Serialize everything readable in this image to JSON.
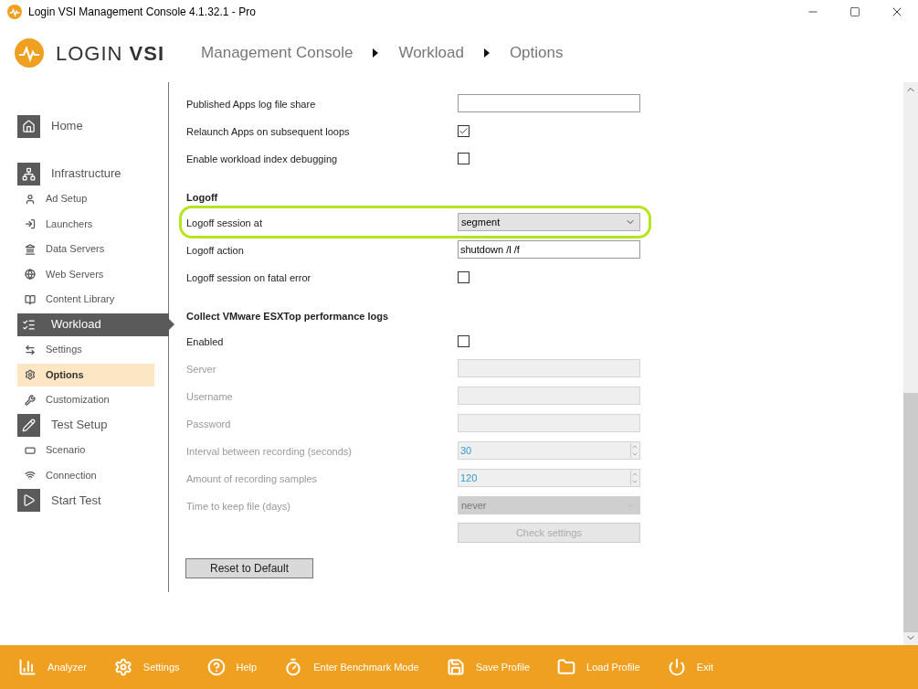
{
  "window": {
    "title": "Login VSI Management Console 4.1.32.1 - Pro"
  },
  "header": {
    "brand_light": "LOGIN",
    "brand_bold": "VSI",
    "breadcrumb": [
      "Management Console",
      "Workload",
      "Options"
    ]
  },
  "sidebar": {
    "items": [
      {
        "kind": "section",
        "label": "Home",
        "selected": false
      },
      {
        "kind": "section",
        "label": "Infrastructure",
        "selected": false
      },
      {
        "kind": "sub",
        "label": "Ad Setup",
        "selected": false
      },
      {
        "kind": "sub",
        "label": "Launchers",
        "selected": false
      },
      {
        "kind": "sub",
        "label": "Data Servers",
        "selected": false
      },
      {
        "kind": "sub",
        "label": "Web Servers",
        "selected": false
      },
      {
        "kind": "sub",
        "label": "Content Library",
        "selected": false
      },
      {
        "kind": "section",
        "label": "Workload",
        "selected": true
      },
      {
        "kind": "sub",
        "label": "Settings",
        "selected": false
      },
      {
        "kind": "sub",
        "label": "Options",
        "selected": true
      },
      {
        "kind": "sub",
        "label": "Customization",
        "selected": false
      },
      {
        "kind": "section",
        "label": "Test Setup",
        "selected": false
      },
      {
        "kind": "sub",
        "label": "Scenario",
        "selected": false
      },
      {
        "kind": "sub",
        "label": "Connection",
        "selected": false
      },
      {
        "kind": "section",
        "label": "Start Test",
        "selected": false
      }
    ]
  },
  "form": {
    "rows": [
      {
        "kind": "text",
        "label": "Published Apps log file share",
        "disabled": false,
        "highlighted": false
      },
      {
        "kind": "checkbox",
        "label": "Relaunch Apps on subsequent loops",
        "checked": true,
        "disabled": false,
        "highlighted": false
      },
      {
        "kind": "checkbox",
        "label": "Enable workload index debugging",
        "checked": false,
        "disabled": false,
        "highlighted": false
      },
      {
        "kind": "heading",
        "label": "Logoff"
      },
      {
        "kind": "select",
        "label": "Logoff session at",
        "value": "segment",
        "disabled": false,
        "highlighted": true
      },
      {
        "kind": "text",
        "label": "Logoff action",
        "value": "shutdown /l /f",
        "disabled": false,
        "highlighted": false
      },
      {
        "kind": "checkbox",
        "label": "Logoff session on fatal error",
        "checked": false,
        "disabled": false,
        "highlighted": false
      },
      {
        "kind": "heading",
        "label": "Collect VMware ESXTop performance logs"
      },
      {
        "kind": "checkbox",
        "label": "Enabled",
        "checked": false,
        "disabled": false,
        "highlighted": false
      },
      {
        "kind": "text",
        "label": "Server",
        "disabled": true,
        "highlighted": false
      },
      {
        "kind": "text",
        "label": "Username",
        "disabled": true,
        "highlighted": false
      },
      {
        "kind": "text",
        "label": "Password",
        "disabled": true,
        "highlighted": false
      },
      {
        "kind": "spinner",
        "label": "Interval between recording (seconds)",
        "value": "30",
        "disabled": true,
        "highlighted": false
      },
      {
        "kind": "spinner",
        "label": "Amount of recording samples",
        "value": "120",
        "disabled": true,
        "highlighted": false
      },
      {
        "kind": "select",
        "label": "Time to keep file (days)",
        "value": "never",
        "disabled": true,
        "highlighted": false
      },
      {
        "kind": "button",
        "label": "Check settings",
        "disabled": true,
        "highlighted": false
      }
    ],
    "reset_button": "Reset to Default"
  },
  "footer": {
    "buttons": [
      "Analyzer",
      "Settings",
      "Help",
      "Enter Benchmark Mode",
      "Save Profile",
      "Load Profile",
      "Exit"
    ]
  }
}
